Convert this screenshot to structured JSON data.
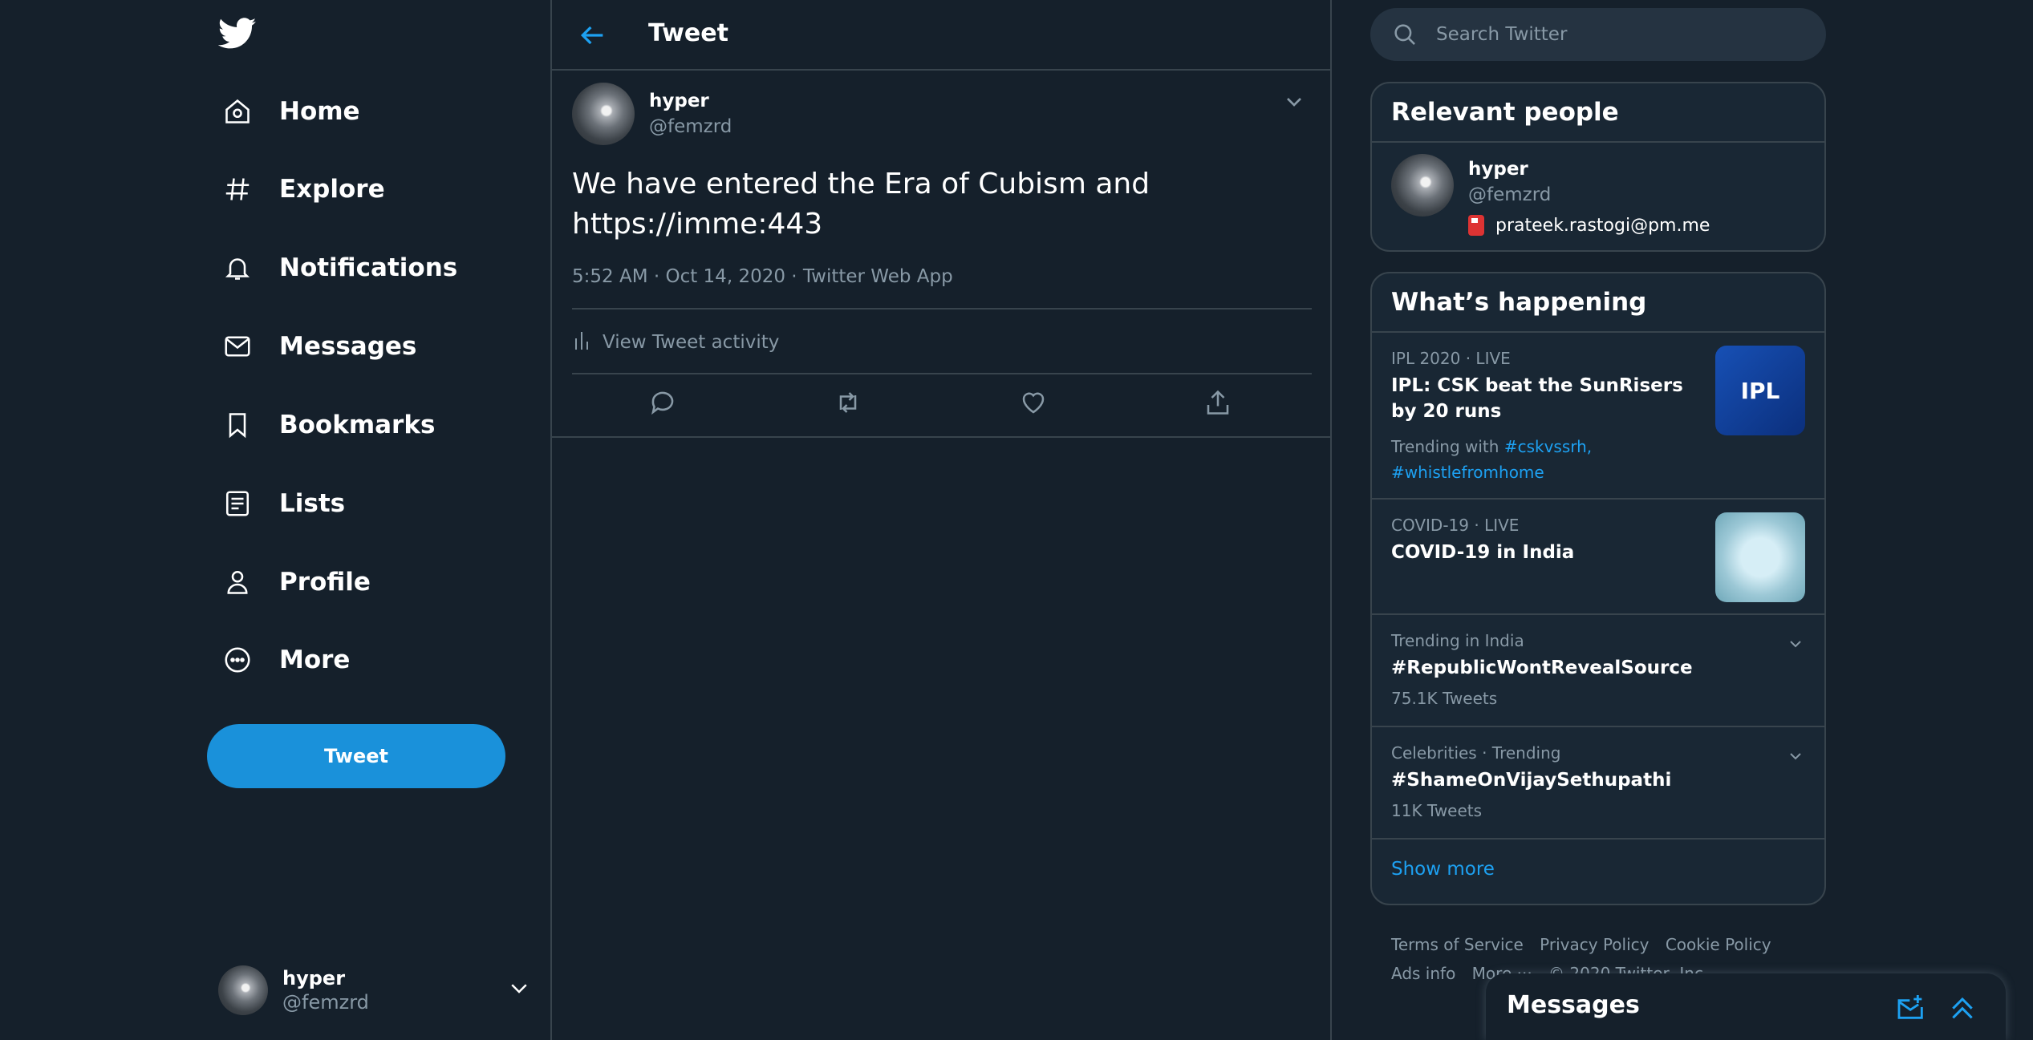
{
  "nav": {
    "items": [
      {
        "label": "Home"
      },
      {
        "label": "Explore"
      },
      {
        "label": "Notifications"
      },
      {
        "label": "Messages"
      },
      {
        "label": "Bookmarks"
      },
      {
        "label": "Lists"
      },
      {
        "label": "Profile"
      },
      {
        "label": "More"
      }
    ],
    "tweet_button": "Tweet",
    "account": {
      "name": "hyper",
      "handle": "@femzrd"
    }
  },
  "main": {
    "title": "Tweet",
    "tweet": {
      "author_name": "hyper",
      "author_handle": "@femzrd",
      "text_line1": "We have entered the Era of Cubism and",
      "text_line2": "https://imme:443",
      "meta": "5:52 AM · Oct 14, 2020 · Twitter Web App",
      "activity_label": "View Tweet activity"
    }
  },
  "search": {
    "placeholder": "Search Twitter"
  },
  "relevant_people": {
    "title": "Relevant people",
    "person": {
      "name": "hyper",
      "handle": "@femzrd",
      "bio": "prateek.rastogi@pm.me"
    }
  },
  "happening": {
    "title": "What’s happening",
    "trends": [
      {
        "context": "IPL 2020 · LIVE",
        "title": "IPL: CSK beat the SunRisers by 20 runs",
        "trending_with": "Trending with",
        "tags": [
          "#cskvssrh,",
          "#whistlefromhome"
        ],
        "thumb_label": "IPL"
      },
      {
        "context": "COVID-19 · LIVE",
        "title": "COVID-19 in India"
      },
      {
        "context": "Trending in India",
        "title": "#RepublicWontRevealSource",
        "count": "75.1K Tweets"
      },
      {
        "context": "Celebrities · Trending",
        "title": "#ShameOnVijaySethupathi",
        "count": "11K Tweets"
      }
    ],
    "show_more": "Show more"
  },
  "footer": {
    "links": [
      "Terms of Service",
      "Privacy Policy",
      "Cookie Policy",
      "Ads info",
      "More ···",
      "© 2020 Twitter, Inc."
    ]
  },
  "messages_dock": {
    "title": "Messages"
  },
  "colors": {
    "background": "#15202b",
    "accent": "#1da1f2",
    "tweet_button": "#1a91da",
    "border": "#38444d",
    "muted": "#8899a6"
  }
}
